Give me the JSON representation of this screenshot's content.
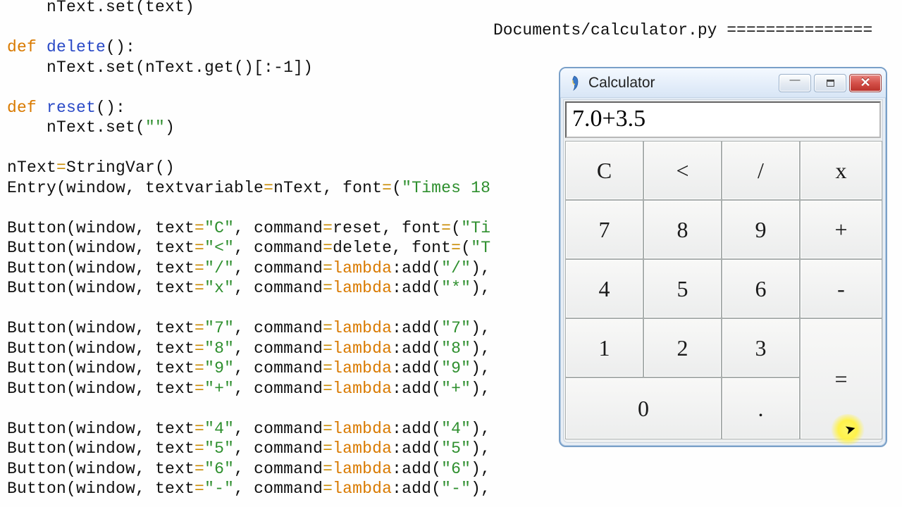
{
  "code_lines": [
    [
      {
        "t": "    nText.set(text)"
      }
    ],
    [],
    [
      {
        "t": "def ",
        "c": "kw"
      },
      {
        "t": "delete",
        "c": "fn"
      },
      {
        "t": "():"
      }
    ],
    [
      {
        "t": "    nText.set(nText.get()[:-1])"
      }
    ],
    [],
    [
      {
        "t": "def ",
        "c": "kw"
      },
      {
        "t": "reset",
        "c": "fn"
      },
      {
        "t": "():"
      }
    ],
    [
      {
        "t": "    nText.set("
      },
      {
        "t": "\"\"",
        "c": "str"
      },
      {
        "t": ")"
      }
    ],
    [],
    [
      {
        "t": "nText"
      },
      {
        "t": "=",
        "c": "op"
      },
      {
        "t": "StringVar()"
      }
    ],
    [
      {
        "t": "Entry(window, textvariable"
      },
      {
        "t": "=",
        "c": "op"
      },
      {
        "t": "nText, font"
      },
      {
        "t": "=",
        "c": "op"
      },
      {
        "t": "("
      },
      {
        "t": "\"Times 18",
        "c": "str"
      }
    ],
    [],
    [
      {
        "t": "Button(window, text"
      },
      {
        "t": "=",
        "c": "op"
      },
      {
        "t": "\"C\"",
        "c": "str"
      },
      {
        "t": ", command"
      },
      {
        "t": "=",
        "c": "op"
      },
      {
        "t": "reset, font"
      },
      {
        "t": "=",
        "c": "op"
      },
      {
        "t": "("
      },
      {
        "t": "\"Ti",
        "c": "str"
      }
    ],
    [
      {
        "t": "Button(window, text"
      },
      {
        "t": "=",
        "c": "op"
      },
      {
        "t": "\"<\"",
        "c": "str"
      },
      {
        "t": ", command"
      },
      {
        "t": "=",
        "c": "op"
      },
      {
        "t": "delete, font"
      },
      {
        "t": "=",
        "c": "op"
      },
      {
        "t": "("
      },
      {
        "t": "\"T",
        "c": "str"
      }
    ],
    [
      {
        "t": "Button(window, text"
      },
      {
        "t": "=",
        "c": "op"
      },
      {
        "t": "\"/\"",
        "c": "str"
      },
      {
        "t": ", command"
      },
      {
        "t": "=",
        "c": "op"
      },
      {
        "t": "lambda",
        "c": "lam"
      },
      {
        "t": ":add("
      },
      {
        "t": "\"/\"",
        "c": "str"
      },
      {
        "t": "),"
      }
    ],
    [
      {
        "t": "Button(window, text"
      },
      {
        "t": "=",
        "c": "op"
      },
      {
        "t": "\"x\"",
        "c": "str"
      },
      {
        "t": ", command"
      },
      {
        "t": "=",
        "c": "op"
      },
      {
        "t": "lambda",
        "c": "lam"
      },
      {
        "t": ":add("
      },
      {
        "t": "\"*\"",
        "c": "str"
      },
      {
        "t": "),"
      }
    ],
    [],
    [
      {
        "t": "Button(window, text"
      },
      {
        "t": "=",
        "c": "op"
      },
      {
        "t": "\"7\"",
        "c": "str"
      },
      {
        "t": ", command"
      },
      {
        "t": "=",
        "c": "op"
      },
      {
        "t": "lambda",
        "c": "lam"
      },
      {
        "t": ":add("
      },
      {
        "t": "\"7\"",
        "c": "str"
      },
      {
        "t": "),"
      }
    ],
    [
      {
        "t": "Button(window, text"
      },
      {
        "t": "=",
        "c": "op"
      },
      {
        "t": "\"8\"",
        "c": "str"
      },
      {
        "t": ", command"
      },
      {
        "t": "=",
        "c": "op"
      },
      {
        "t": "lambda",
        "c": "lam"
      },
      {
        "t": ":add("
      },
      {
        "t": "\"8\"",
        "c": "str"
      },
      {
        "t": "),"
      }
    ],
    [
      {
        "t": "Button(window, text"
      },
      {
        "t": "=",
        "c": "op"
      },
      {
        "t": "\"9\"",
        "c": "str"
      },
      {
        "t": ", command"
      },
      {
        "t": "=",
        "c": "op"
      },
      {
        "t": "lambda",
        "c": "lam"
      },
      {
        "t": ":add("
      },
      {
        "t": "\"9\"",
        "c": "str"
      },
      {
        "t": "),"
      }
    ],
    [
      {
        "t": "Button(window, text"
      },
      {
        "t": "=",
        "c": "op"
      },
      {
        "t": "\"+\"",
        "c": "str"
      },
      {
        "t": ", command"
      },
      {
        "t": "=",
        "c": "op"
      },
      {
        "t": "lambda",
        "c": "lam"
      },
      {
        "t": ":add("
      },
      {
        "t": "\"+\"",
        "c": "str"
      },
      {
        "t": "),"
      }
    ],
    [],
    [
      {
        "t": "Button(window, text"
      },
      {
        "t": "=",
        "c": "op"
      },
      {
        "t": "\"4\"",
        "c": "str"
      },
      {
        "t": ", command"
      },
      {
        "t": "=",
        "c": "op"
      },
      {
        "t": "lambda",
        "c": "lam"
      },
      {
        "t": ":add("
      },
      {
        "t": "\"4\"",
        "c": "str"
      },
      {
        "t": "),"
      }
    ],
    [
      {
        "t": "Button(window, text"
      },
      {
        "t": "=",
        "c": "op"
      },
      {
        "t": "\"5\"",
        "c": "str"
      },
      {
        "t": ", command"
      },
      {
        "t": "=",
        "c": "op"
      },
      {
        "t": "lambda",
        "c": "lam"
      },
      {
        "t": ":add("
      },
      {
        "t": "\"5\"",
        "c": "str"
      },
      {
        "t": "),"
      }
    ],
    [
      {
        "t": "Button(window, text"
      },
      {
        "t": "=",
        "c": "op"
      },
      {
        "t": "\"6\"",
        "c": "str"
      },
      {
        "t": ", command"
      },
      {
        "t": "=",
        "c": "op"
      },
      {
        "t": "lambda",
        "c": "lam"
      },
      {
        "t": ":add("
      },
      {
        "t": "\"6\"",
        "c": "str"
      },
      {
        "t": "),"
      }
    ],
    [
      {
        "t": "Button(window, text"
      },
      {
        "t": "=",
        "c": "op"
      },
      {
        "t": "\"-\"",
        "c": "str"
      },
      {
        "t": ", command"
      },
      {
        "t": "=",
        "c": "op"
      },
      {
        "t": "lambda",
        "c": "lam"
      },
      {
        "t": ":add("
      },
      {
        "t": "\"-\"",
        "c": "str"
      },
      {
        "t": "),"
      }
    ]
  ],
  "shell": "Documents/calculator.py ===============",
  "window": {
    "title": "Calculator"
  },
  "display_value": "7.0+3.5",
  "buttons": {
    "r0": [
      "C",
      "<",
      "/",
      "x"
    ],
    "r1": [
      "7",
      "8",
      "9",
      "+"
    ],
    "r2": [
      "4",
      "5",
      "6",
      "-"
    ],
    "r3": [
      "1",
      "2",
      "3"
    ],
    "r4": [
      "0",
      "."
    ],
    "equals": "="
  }
}
